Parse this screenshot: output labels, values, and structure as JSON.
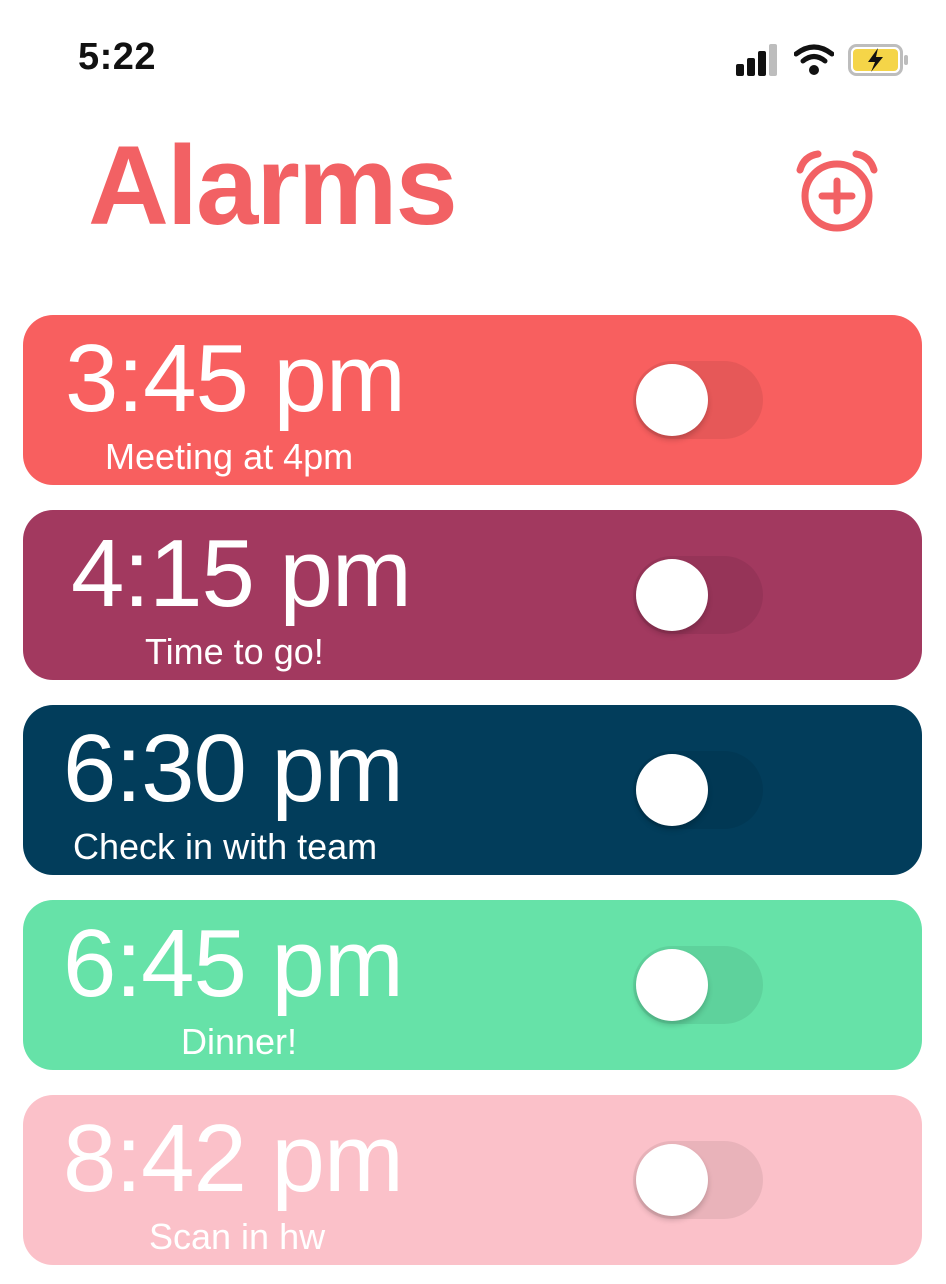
{
  "status_bar": {
    "time": "5:22",
    "signal_icon": "cellular-signal-icon",
    "wifi_icon": "wifi-icon",
    "battery_icon": "battery-charging-icon",
    "battery_color": "#F5D548"
  },
  "header": {
    "title": "Alarms",
    "title_color": "#F26164",
    "add_button_icon": "alarm-clock-plus-icon",
    "add_button_color": "#F26164"
  },
  "alarms": [
    {
      "time": "3:45 pm",
      "label": "Meeting at 4pm",
      "color": "#F85F5F",
      "enabled": false
    },
    {
      "time": "4:15 pm",
      "label": "Time to go!",
      "color": "#A2395F",
      "enabled": false
    },
    {
      "time": "6:30 pm",
      "label": "Check in with team",
      "color": "#023D5B",
      "enabled": false
    },
    {
      "time": "6:45 pm",
      "label": "Dinner!",
      "color": "#66E2A8",
      "enabled": false
    },
    {
      "time": "8:42 pm",
      "label": "Scan in hw",
      "color": "#FBC1C9",
      "enabled": false
    }
  ]
}
